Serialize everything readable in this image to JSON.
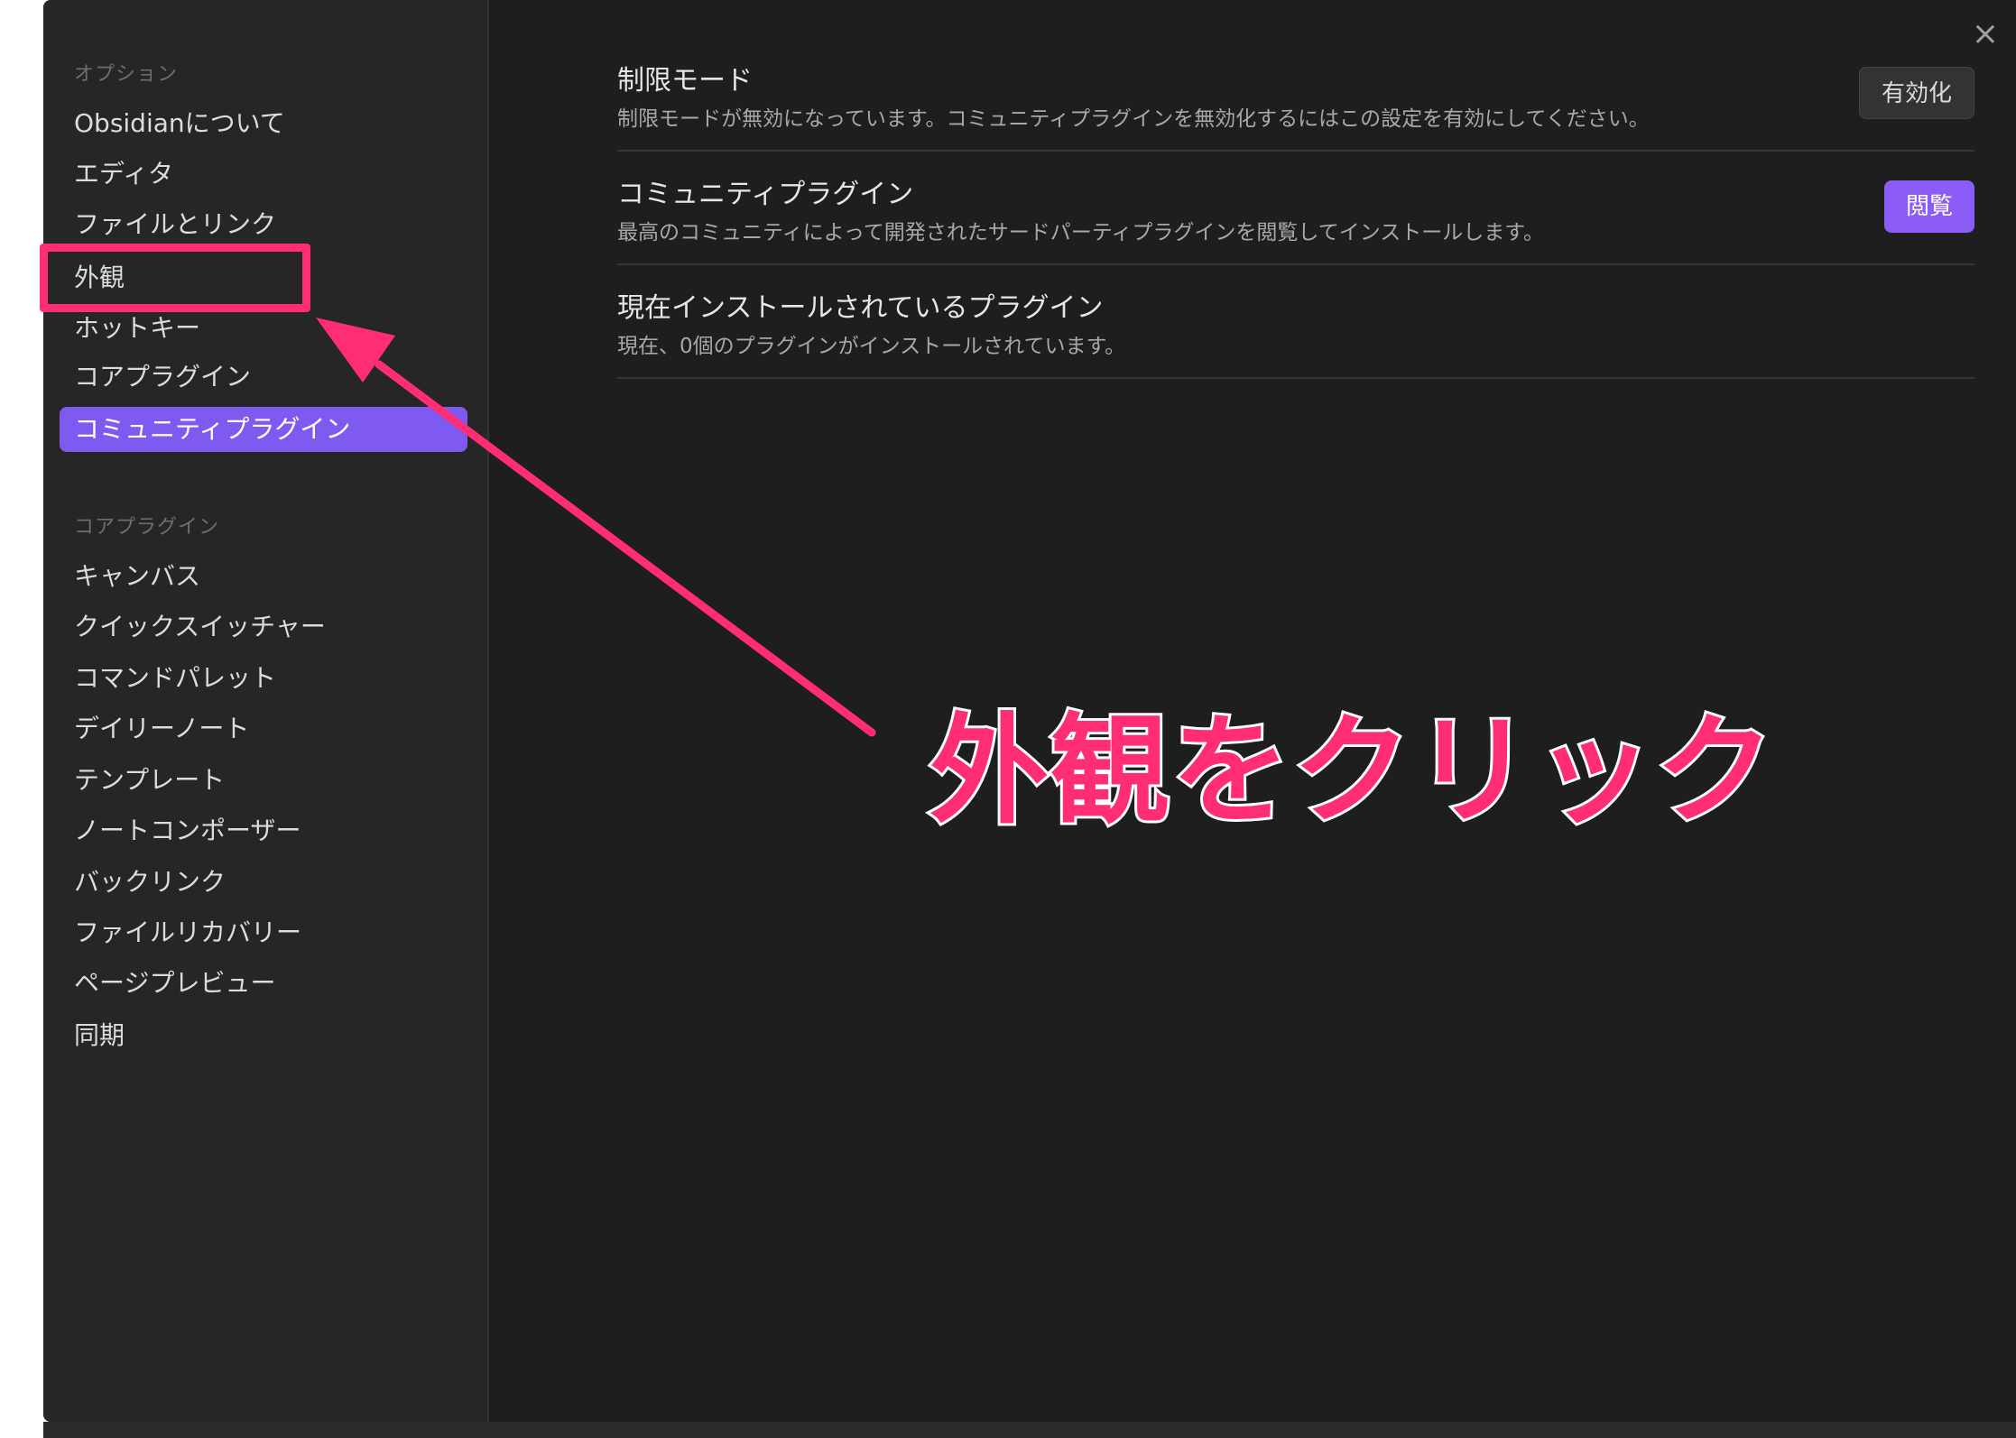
{
  "sidebar": {
    "options_heading": "オプション",
    "options_items": [
      {
        "label": "Obsidianについて"
      },
      {
        "label": "エディタ"
      },
      {
        "label": "ファイルとリンク"
      },
      {
        "label": "外観"
      },
      {
        "label": "ホットキー"
      },
      {
        "label": "コアプラグイン"
      },
      {
        "label": "コミュニティプラグイン",
        "active": true
      }
    ],
    "core_heading": "コアプラグイン",
    "core_items": [
      {
        "label": "キャンバス"
      },
      {
        "label": "クイックスイッチャー"
      },
      {
        "label": "コマンドパレット"
      },
      {
        "label": "デイリーノート"
      },
      {
        "label": "テンプレート"
      },
      {
        "label": "ノートコンポーザー"
      },
      {
        "label": "バックリンク"
      },
      {
        "label": "ファイルリカバリー"
      },
      {
        "label": "ページプレビュー"
      },
      {
        "label": "同期"
      }
    ]
  },
  "settings": [
    {
      "title": "制限モード",
      "description": "制限モードが無効になっています。コミュニティプラグインを無効化するにはこの設定を有効にしてください。",
      "button": "有効化"
    },
    {
      "title": "コミュニティプラグイン",
      "description": "最高のコミュニティによって開発されたサードパーティプラグインを閲覧してインストールします。",
      "button": "閲覧"
    },
    {
      "title": "現在インストールされているプラグイン",
      "description": "現在、0個のプラグインがインストールされています。"
    }
  ],
  "close_icon": "×",
  "annotation": {
    "text": "外観をクリック"
  },
  "colors": {
    "accent": "#8b5cf6",
    "annotation": "#ff2d73",
    "background": "#1e1e1e",
    "sidebar": "#262626"
  }
}
